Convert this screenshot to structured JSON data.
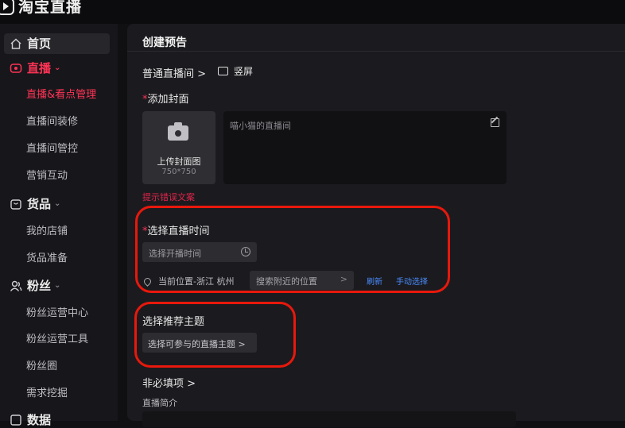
{
  "app": {
    "brand": "淘宝直播"
  },
  "sidebar": {
    "groups": [
      {
        "label": "首页",
        "icon": "home-icon"
      },
      {
        "label": "直播",
        "icon": "live-icon",
        "active": true
      },
      {
        "label": "货品",
        "icon": "goods-icon"
      },
      {
        "label": "粉丝",
        "icon": "fans-icon"
      },
      {
        "label": "数据",
        "icon": "data-icon"
      }
    ],
    "live_items": [
      "直播&看点管理",
      "直播间装修",
      "直播间管控",
      "营销互动"
    ],
    "goods_items": [
      "我的店铺",
      "货品准备"
    ],
    "fans_items": [
      "粉丝运营中心",
      "粉丝运营工具",
      "粉丝圈",
      "需求挖掘"
    ]
  },
  "main": {
    "title": "创建预告",
    "room_type": "普通直播间 >",
    "orientation": "竖屏",
    "cover": {
      "label": "添加封面",
      "required_mark": "*",
      "upload_text": "上传封面图",
      "size_hint": "750*750"
    },
    "title_input": {
      "value": "喵小猫的直播间"
    },
    "error_text": "提示错误文案",
    "time": {
      "label": "选择直播时间",
      "required_mark": "*",
      "placeholder": "选择开播时间"
    },
    "location": {
      "current": "当前位置-浙江 杭州",
      "search_placeholder": "搜索附近的位置",
      "refresh": "刷新",
      "manual": "手动选择"
    },
    "topic": {
      "label": "选择推荐主题",
      "placeholder": "选择可参与的直播主题 >"
    },
    "optional_label": "非必填项 >",
    "intro_label": "直播简介"
  },
  "colors": {
    "accent": "#ff3355",
    "link": "#4a8cff",
    "highlight": "#e8180c"
  }
}
